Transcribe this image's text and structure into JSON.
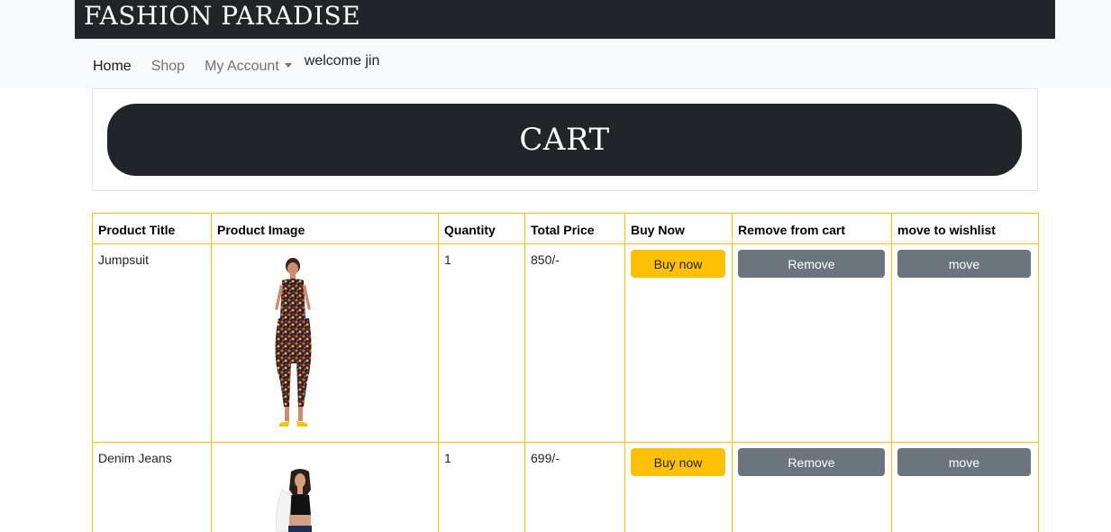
{
  "header": {
    "brand": "FASHION PARADISE"
  },
  "nav": {
    "items": [
      {
        "label": "Home"
      },
      {
        "label": "Shop"
      },
      {
        "label": "My Account"
      }
    ],
    "welcome": "welcome jin"
  },
  "cart": {
    "title": "CART"
  },
  "table": {
    "headers": [
      "Product Title",
      "Product Image",
      "Quantity",
      "Total Price",
      "Buy Now",
      "Remove from cart",
      "move to wishlist"
    ],
    "rows": [
      {
        "title": "Jumpsuit",
        "quantity": "1",
        "total": "850/-",
        "buy_label": "Buy now",
        "remove_label": "Remove",
        "move_label": "move"
      },
      {
        "title": "Denim Jeans",
        "quantity": "1",
        "total": "699/-",
        "buy_label": "Buy now",
        "remove_label": "Remove",
        "move_label": "move"
      }
    ]
  },
  "colors": {
    "dark": "#212529",
    "accent": "#ffc107",
    "secondary": "#6c757d",
    "light": "#f8f9fa"
  }
}
